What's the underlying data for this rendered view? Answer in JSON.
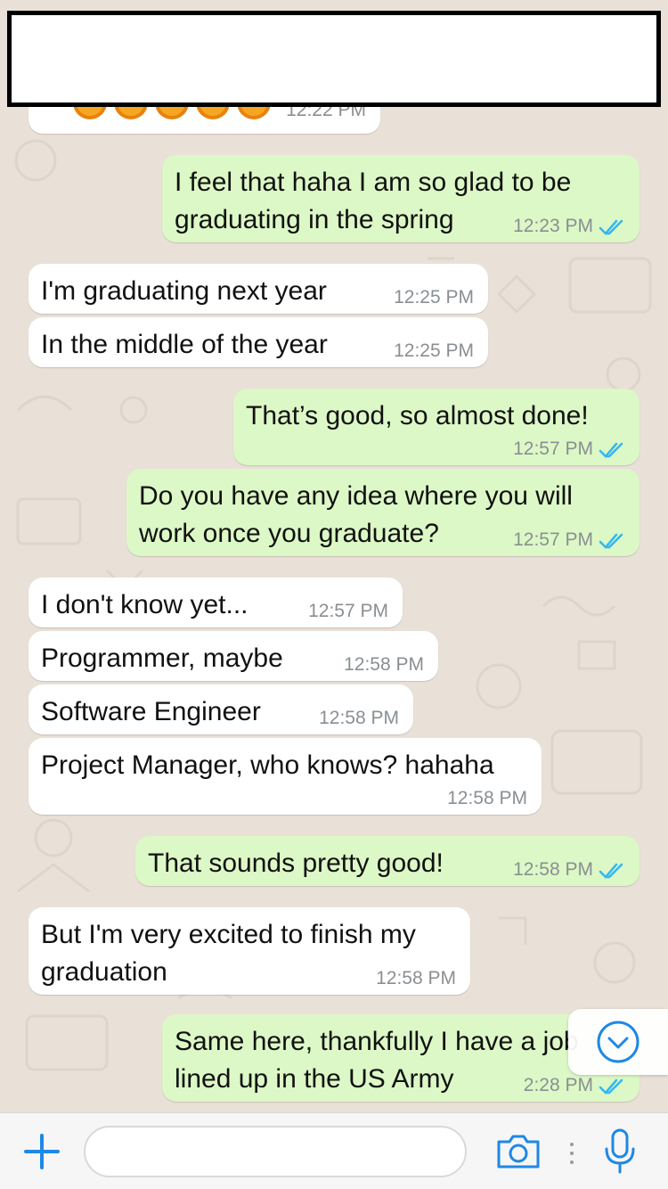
{
  "previous_message": {
    "time": "12:22 PM"
  },
  "messages": [
    {
      "dir": "out",
      "lines": [
        "I feel that haha I am so glad to be",
        "graduating in the spring"
      ],
      "time": "12:23 PM",
      "read": true
    },
    {
      "dir": "in",
      "lines": [
        "I'm graduating next year"
      ],
      "time": "12:25 PM"
    },
    {
      "dir": "in",
      "lines": [
        "In the middle of the year"
      ],
      "time": "12:25 PM"
    },
    {
      "dir": "out",
      "lines": [
        "That’s good, so almost done!"
      ],
      "time": "12:57 PM",
      "read": true
    },
    {
      "dir": "out",
      "lines": [
        "Do you have any idea where you will",
        "work once you graduate?"
      ],
      "time": "12:57 PM",
      "read": true
    },
    {
      "dir": "in",
      "lines": [
        "I don't know yet..."
      ],
      "time": "12:57 PM"
    },
    {
      "dir": "in",
      "lines": [
        "Programmer, maybe"
      ],
      "time": "12:58 PM"
    },
    {
      "dir": "in",
      "lines": [
        "Software Engineer"
      ],
      "time": "12:58 PM"
    },
    {
      "dir": "in",
      "lines": [
        "Project Manager, who knows? hahaha"
      ],
      "time": "12:58 PM"
    },
    {
      "dir": "out",
      "lines": [
        "That sounds pretty good!"
      ],
      "time": "12:58 PM",
      "read": true
    },
    {
      "dir": "in",
      "lines": [
        "But I'm very excited to finish my",
        "graduation"
      ],
      "time": "12:58 PM"
    },
    {
      "dir": "out",
      "lines": [
        "Same here, thankfully I have a job",
        "lined up in the US Army"
      ],
      "time": "2:28 PM",
      "read": true
    }
  ],
  "input_bar": {
    "placeholder": "",
    "icons": [
      "plus-icon",
      "camera-icon",
      "microphone-icon"
    ]
  },
  "colors": {
    "outgoing": "#dcf8c6",
    "incoming": "#ffffff",
    "accent": "#1e88e5",
    "read_ticks": "#34b7f1"
  }
}
